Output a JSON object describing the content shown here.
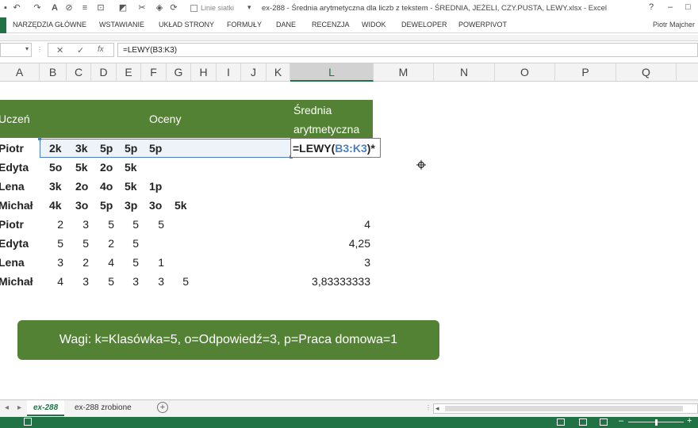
{
  "window": {
    "title": "ex-288 - Średnia arytmetyczna dla liczb z tekstem - ŚREDNIA, JEŻELI, CZY.PUSTA, LEWY.xlsx - Excel",
    "quick_access_gridlines": "Linie siatki",
    "controls": [
      "?",
      "–",
      "□"
    ]
  },
  "ribbon": {
    "tabs": [
      "NARZĘDZIA GŁÓWNE",
      "WSTAWIANIE",
      "UKŁAD STRONY",
      "FORMUŁY",
      "DANE",
      "RECENZJA",
      "WIDOK",
      "DEWELOPER",
      "POWERPIVOT"
    ],
    "user": "Piotr Majcher"
  },
  "formula_bar": {
    "cancel": "✕",
    "enter": "✓",
    "fx": "fx",
    "value": "=LEWY(B3:K3)"
  },
  "columns": [
    "A",
    "B",
    "C",
    "D",
    "E",
    "F",
    "G",
    "H",
    "I",
    "J",
    "K",
    "L",
    "M",
    "N",
    "O",
    "P",
    "Q"
  ],
  "header": {
    "uczen": "Uczeń",
    "oceny": "Oceny",
    "srednia_line1": "Średnia",
    "srednia_line2": "arytmetyczna"
  },
  "rows_text": [
    {
      "name": "Piotr",
      "grades": [
        "2k",
        "3k",
        "5p",
        "5p",
        "5p"
      ]
    },
    {
      "name": "Edyta",
      "grades": [
        "5o",
        "5k",
        "2o",
        "5k"
      ]
    },
    {
      "name": "Lena",
      "grades": [
        "3k",
        "2o",
        "4o",
        "5k",
        "1p"
      ]
    },
    {
      "name": "Michał",
      "grades": [
        "4k",
        "3o",
        "5p",
        "3p",
        "3o",
        "5k"
      ]
    }
  ],
  "rows_num": [
    {
      "name": "Piotr",
      "grades": [
        "2",
        "3",
        "5",
        "5",
        "5"
      ],
      "avg": "4"
    },
    {
      "name": "Edyta",
      "grades": [
        "5",
        "5",
        "2",
        "5"
      ],
      "avg": "4,25"
    },
    {
      "name": "Lena",
      "grades": [
        "3",
        "2",
        "4",
        "5",
        "1"
      ],
      "avg": "3"
    },
    {
      "name": "Michał",
      "grades": [
        "4",
        "3",
        "5",
        "3",
        "3",
        "5"
      ],
      "avg": "3,83333333"
    }
  ],
  "edit_cell": {
    "prefix": "=LEWY(",
    "ref": "B3:K3",
    "suffix": ")*"
  },
  "note": "Wagi: k=Klasówka=5, o=Odpowiedź=3, p=Praca domowa=1",
  "sheets": [
    "ex-288",
    "ex-288 zrobione"
  ],
  "colors": {
    "accent": "#217346",
    "header_band": "#548235",
    "ref_blue": "#4a7fc1"
  }
}
